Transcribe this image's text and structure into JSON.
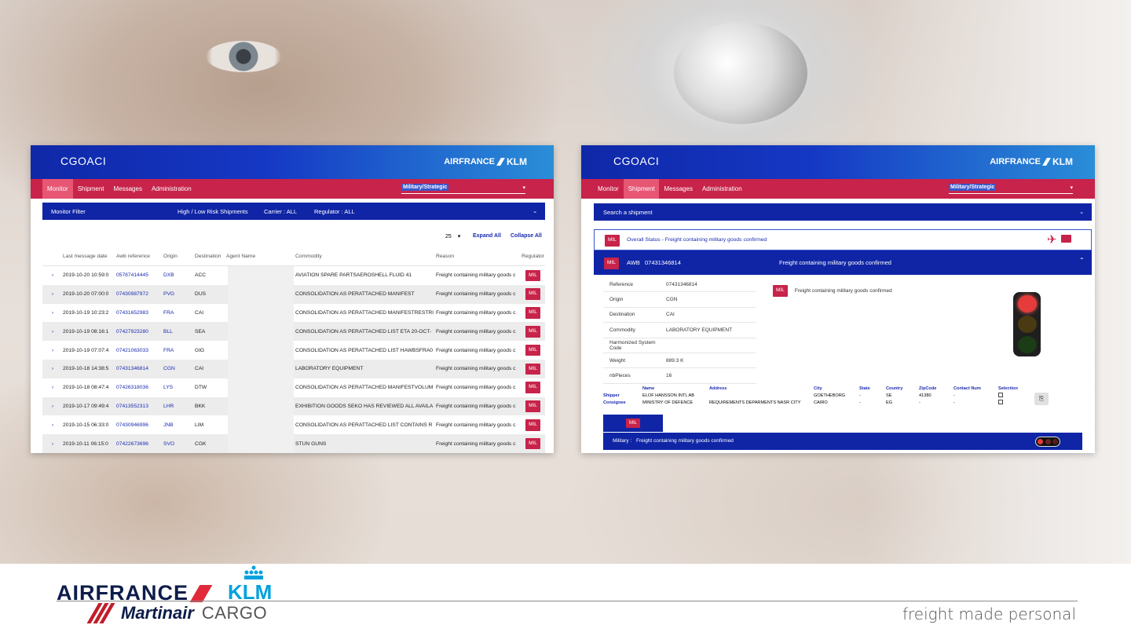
{
  "colors": {
    "header_blue": "#1538c4",
    "nav_red": "#c8234a",
    "filter_blue": "#0f25a6",
    "link_blue": "#1a2bb0",
    "mil_red": "#c8234a"
  },
  "footer": {
    "airfrance": "AIRFRANCE",
    "klm": "KLM",
    "martinair": "Martinair",
    "cargo": "CARGO",
    "tagline": "freight made personal"
  },
  "left_window": {
    "app_title": "CGOACI",
    "brand": {
      "airfrance": "AIRFRANCE",
      "klm": "KLM"
    },
    "nav": [
      "Monitor",
      "Shipment",
      "Messages",
      "Administration"
    ],
    "active_nav": "Monitor",
    "category_select": "Military/Strategic",
    "filter": {
      "label": "Monitor Filter",
      "risk": "High / Low Risk Shipments",
      "carrier": "Carrier : ALL",
      "regulator": "Regulator : ALL"
    },
    "pager": {
      "page_size": "25",
      "expand_all": "Expand All",
      "collapse_all": "Collapse All"
    },
    "table": {
      "headers": [
        "Last message date",
        "Awb reference",
        "Origin",
        "Destination",
        "Agent Name",
        "Commodity",
        "Reason",
        "Regulator"
      ],
      "rows": [
        {
          "date": "2019-10-20 10:59:0",
          "awb": "05787414445",
          "origin": "DXB",
          "dest": "ACC",
          "commodity": "AVIATION SPARE PARTSAEROSHELL FLUID 41",
          "reason": "Freight containing military goods c",
          "regulator": "MIL"
        },
        {
          "date": "2019-10-20 07:00:0",
          "awb": "07430987972",
          "origin": "PVG",
          "dest": "DUS",
          "commodity": "CONSOLIDATION AS PERATTACHED MANIFEST",
          "reason": "Freight containing military goods c",
          "regulator": "MIL"
        },
        {
          "date": "2019-10-19 10:23:2",
          "awb": "07431652983",
          "origin": "FRA",
          "dest": "CAI",
          "commodity": "CONSOLIDATION AS PERATTACHED MANIFESTRESTRI",
          "reason": "Freight containing military goods c",
          "regulator": "MIL"
        },
        {
          "date": "2019-10-19 08:16:1",
          "awb": "07427923280",
          "origin": "BLL",
          "dest": "SEA",
          "commodity": "CONSOLIDATION AS PERATTACHED LIST ETA 20-OCT-",
          "reason": "Freight containing military goods c",
          "regulator": "MIL"
        },
        {
          "date": "2019-10-19 07:07:4",
          "awb": "07421063033",
          "origin": "FRA",
          "dest": "GIG",
          "commodity": "CONSOLIDATION AS PERATTACHED LIST HAWBSFRA0",
          "reason": "Freight containing military goods c",
          "regulator": "MIL"
        },
        {
          "date": "2019-10-18 14:38:5",
          "awb": "07431346814",
          "origin": "CGN",
          "dest": "CAI",
          "commodity": "LABORATORY EQUIPMENT",
          "reason": "Freight containing military goods c",
          "regulator": "MIL"
        },
        {
          "date": "2019-10-18 08:47:4",
          "awb": "07426318036",
          "origin": "LYS",
          "dest": "DTW",
          "commodity": "CONSOLIDATION AS PERATTACHED MANIFESTVOLUM",
          "reason": "Freight containing military goods c",
          "regulator": "MIL"
        },
        {
          "date": "2019-10-17 09:49:4",
          "awb": "07413552313",
          "origin": "LHR",
          "dest": "BKK",
          "commodity": "EXHIBITION GOODS SEKO HAS REVIEWED ALL AVAILA",
          "reason": "Freight containing military goods c",
          "regulator": "MIL"
        },
        {
          "date": "2019-10-15 06:33:0",
          "awb": "07430946996",
          "origin": "JNB",
          "dest": "LIM",
          "commodity": "CONSOLIDATION AS PERATTACHED LIST CONTAINS R",
          "reason": "Freight containing military goods c",
          "regulator": "MIL"
        },
        {
          "date": "2019-10-11 06:15:0",
          "awb": "07422673696",
          "origin": "SVO",
          "dest": "CGK",
          "commodity": "STUN GUNS",
          "reason": "Freight containing military goods c",
          "regulator": "MIL"
        }
      ]
    }
  },
  "right_window": {
    "app_title": "CGOACI",
    "brand": {
      "airfrance": "AIRFRANCE",
      "klm": "KLM"
    },
    "nav": [
      "Monitor",
      "Shipment",
      "Messages",
      "Administration"
    ],
    "active_nav": "Shipment",
    "category_select": "Military/Strategic",
    "search_label": "Search a shipment",
    "overall": {
      "badge": "MIL",
      "text": "Overall Status - Freight containing military goods confirmed"
    },
    "awb_bar": {
      "badge": "MIL",
      "awb_label": "AWB",
      "awb": "07431346814",
      "status": "Freight containing military goods confirmed"
    },
    "details": [
      {
        "label": "Reference",
        "value": "07431346814"
      },
      {
        "label": "Origin",
        "value": "CGN"
      },
      {
        "label": "Destination",
        "value": "CAI"
      },
      {
        "label": "Commodity",
        "value": "LABORATORY EQUIPMENT"
      },
      {
        "label": "Harmonized System Code",
        "value": ""
      },
      {
        "label": "Weight",
        "value": "889.3 K"
      },
      {
        "label": "nbPieces",
        "value": "16"
      }
    ],
    "regulator_line": {
      "badge": "MIL",
      "text": "Freight containing military goods confirmed"
    },
    "parties": {
      "headers": [
        "Name",
        "Address",
        "City",
        "State",
        "Country",
        "ZipCode",
        "Contact Num",
        "Selection"
      ],
      "rows": [
        {
          "role": "Shipper",
          "name": "ELOF HANSSON INTL AB",
          "address": "",
          "city": "GOETHEBORG",
          "state": "-",
          "country": "SE",
          "zip": "41380",
          "contact": "-"
        },
        {
          "role": "Consignee",
          "name": "MINISTRY OF DEFENCE",
          "address": "REQUIREMENTS DEPARMENTS NASR CITY",
          "city": "CAIRO",
          "state": "-",
          "country": "EG",
          "zip": "-",
          "contact": "-"
        }
      ]
    },
    "mil_tab": "MIL",
    "military_bar": {
      "label": "Military :",
      "text": "Freight containing military goods confirmed"
    }
  }
}
